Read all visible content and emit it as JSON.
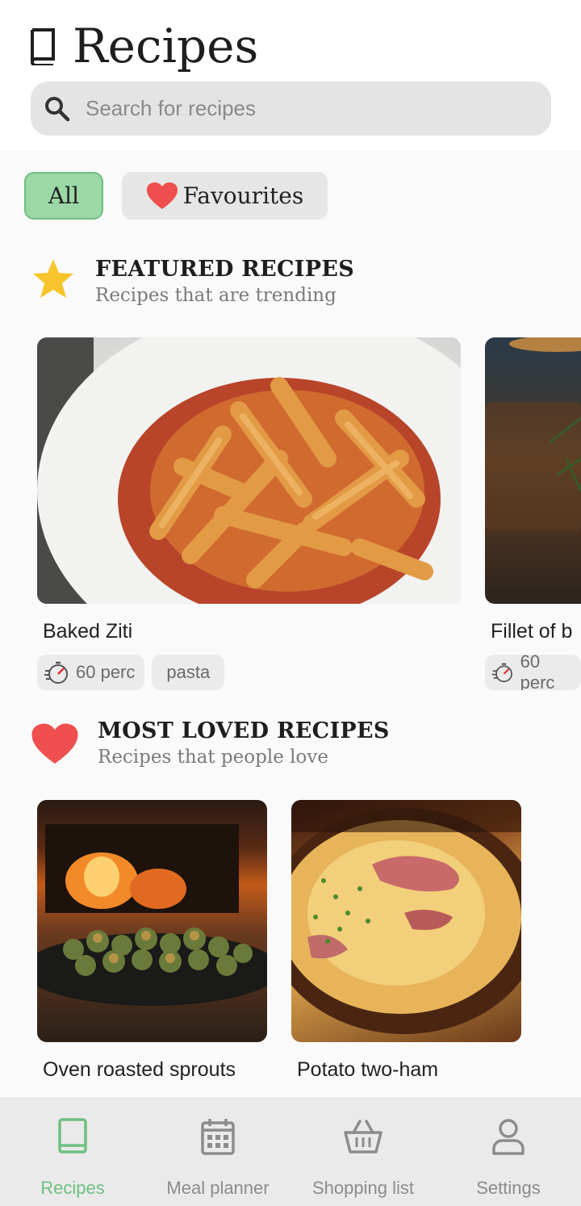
{
  "header": {
    "title": "Recipes"
  },
  "search": {
    "placeholder": "Search for recipes"
  },
  "filters": {
    "all_label": "All",
    "favourites_label": "Favourites"
  },
  "featured": {
    "title": "FEATURED RECIPES",
    "subtitle": "Recipes that are trending",
    "cards": [
      {
        "name": "Baked Ziti",
        "time": "60 perc",
        "tag": "pasta"
      },
      {
        "name": "Fillet of b",
        "time": "60 perc"
      }
    ]
  },
  "loved": {
    "title": "MOST LOVED RECIPES",
    "subtitle": "Recipes that people love",
    "cards": [
      {
        "name": "Oven roasted sprouts"
      },
      {
        "name": "Potato two-ham"
      }
    ]
  },
  "nav": {
    "items": [
      {
        "label": "Recipes",
        "icon": "book-icon",
        "active": true
      },
      {
        "label": "Meal planner",
        "icon": "calendar-icon"
      },
      {
        "label": "Shopping list",
        "icon": "basket-icon"
      },
      {
        "label": "Settings",
        "icon": "person-icon"
      }
    ]
  },
  "colors": {
    "accent": "#6fbf81",
    "chip_active_bg": "#9bd8a6",
    "heart": "#f04f4f",
    "star": "#f7c52b"
  }
}
